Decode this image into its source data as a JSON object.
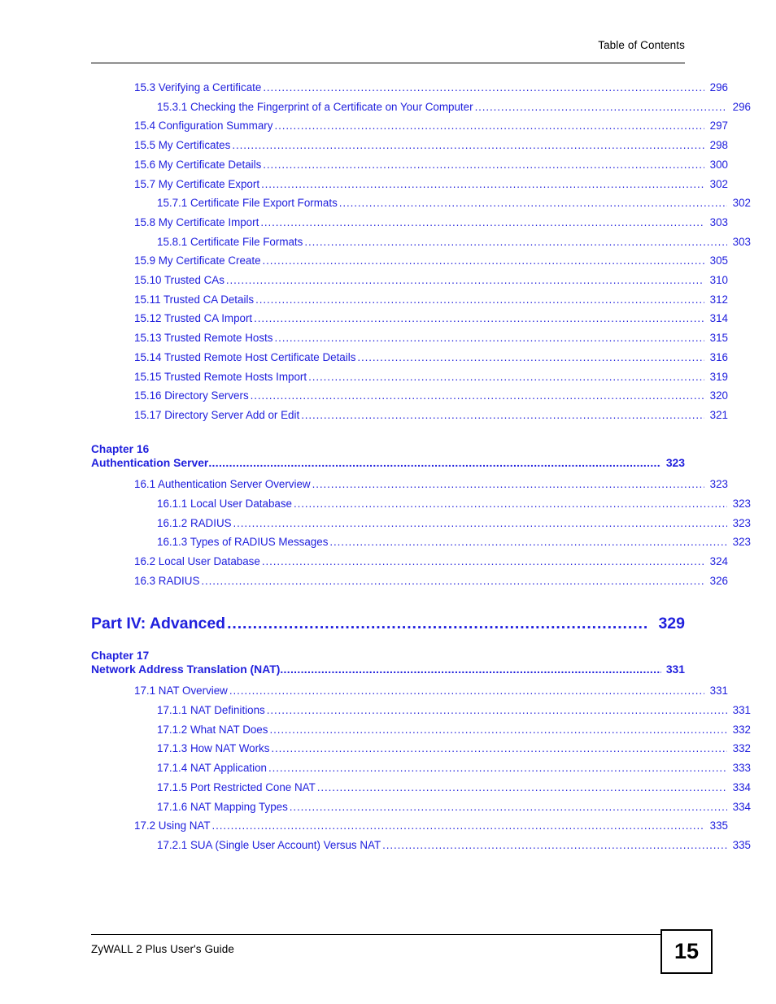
{
  "header": {
    "title": "Table of Contents"
  },
  "footer": {
    "guide_title": "ZyWALL 2 Plus User's Guide",
    "page_number": "15"
  },
  "toc": {
    "group_15": [
      {
        "level": 1,
        "label": "15.3 Verifying a Certificate",
        "page": "296"
      },
      {
        "level": 2,
        "label": "15.3.1 Checking the Fingerprint of a Certificate on Your Computer",
        "page": "296"
      },
      {
        "level": 1,
        "label": "15.4 Configuration Summary",
        "page": "297"
      },
      {
        "level": 1,
        "label": "15.5 My Certificates",
        "page": "298"
      },
      {
        "level": 1,
        "label": "15.6 My Certificate Details",
        "page": "300"
      },
      {
        "level": 1,
        "label": "15.7 My Certificate Export",
        "page": "302"
      },
      {
        "level": 2,
        "label": "15.7.1 Certificate File Export Formats",
        "page": "302"
      },
      {
        "level": 1,
        "label": "15.8 My Certificate Import",
        "page": "303"
      },
      {
        "level": 2,
        "label": "15.8.1 Certificate File Formats",
        "page": "303"
      },
      {
        "level": 1,
        "label": "15.9 My Certificate Create",
        "page": "305"
      },
      {
        "level": 1,
        "label": "15.10 Trusted CAs",
        "page": "310"
      },
      {
        "level": 1,
        "label": "15.11 Trusted CA Details",
        "page": "312"
      },
      {
        "level": 1,
        "label": "15.12 Trusted CA Import",
        "page": "314"
      },
      {
        "level": 1,
        "label": "15.13 Trusted Remote Hosts",
        "page": "315"
      },
      {
        "level": 1,
        "label": "15.14 Trusted Remote Host Certificate Details",
        "page": "316"
      },
      {
        "level": 1,
        "label": "15.15 Trusted Remote Hosts Import",
        "page": "319"
      },
      {
        "level": 1,
        "label": "15.16 Directory Servers",
        "page": "320"
      },
      {
        "level": 1,
        "label": "15.17 Directory Server Add or Edit",
        "page": "321"
      }
    ],
    "chapter_16": {
      "number_label": "Chapter  16",
      "title": "Authentication Server",
      "page": "323",
      "entries": [
        {
          "level": 1,
          "label": "16.1 Authentication Server Overview",
          "page": "323"
        },
        {
          "level": 2,
          "label": "16.1.1 Local User Database",
          "page": "323"
        },
        {
          "level": 2,
          "label": "16.1.2 RADIUS",
          "page": "323"
        },
        {
          "level": 2,
          "label": "16.1.3 Types of RADIUS Messages",
          "page": "323"
        },
        {
          "level": 1,
          "label": "16.2 Local User Database",
          "page": "324"
        },
        {
          "level": 1,
          "label": "16.3 RADIUS",
          "page": "326"
        }
      ]
    },
    "part_4": {
      "title": "Part IV: Advanced",
      "page": "329"
    },
    "chapter_17": {
      "number_label": "Chapter  17",
      "title": "Network Address Translation (NAT)",
      "page": "331",
      "entries": [
        {
          "level": 1,
          "label": "17.1 NAT Overview",
          "page": "331"
        },
        {
          "level": 2,
          "label": "17.1.1 NAT Definitions",
          "page": "331"
        },
        {
          "level": 2,
          "label": "17.1.2 What NAT Does",
          "page": "332"
        },
        {
          "level": 2,
          "label": "17.1.3 How NAT Works",
          "page": "332"
        },
        {
          "level": 2,
          "label": "17.1.4 NAT Application",
          "page": "333"
        },
        {
          "level": 2,
          "label": "17.1.5 Port Restricted Cone NAT",
          "page": "334"
        },
        {
          "level": 2,
          "label": "17.1.6 NAT Mapping Types",
          "page": "334"
        },
        {
          "level": 1,
          "label": "17.2 Using NAT",
          "page": "335"
        },
        {
          "level": 2,
          "label": "17.2.1 SUA (Single User Account) Versus NAT",
          "page": "335"
        }
      ]
    }
  },
  "colors": {
    "link_blue": "#2020dd",
    "text_black": "#000000"
  }
}
